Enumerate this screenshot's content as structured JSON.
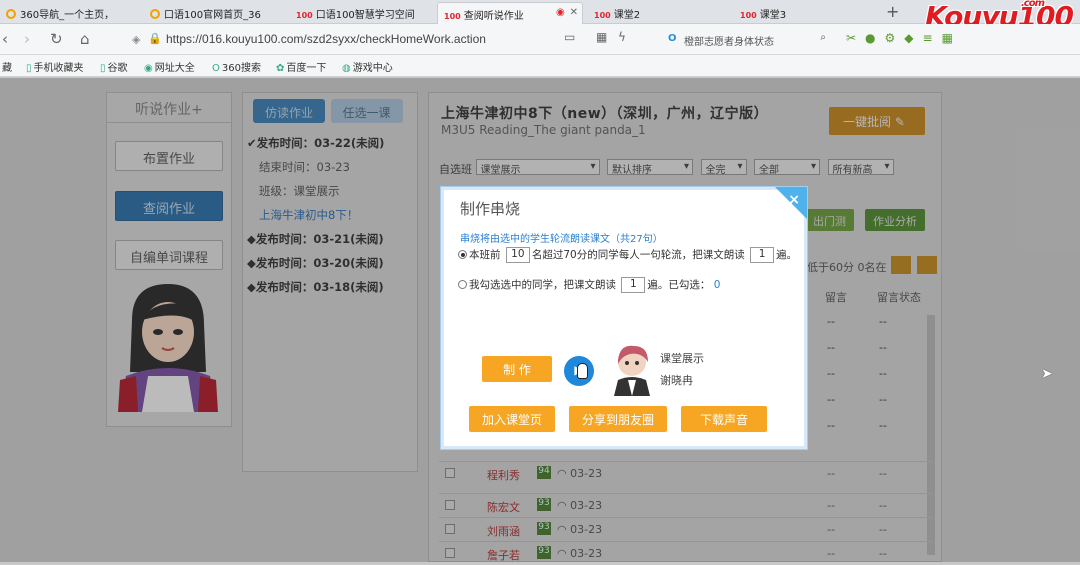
{
  "browser": {
    "tabs": [
      {
        "label": "360导航_一个主页，"
      },
      {
        "label": "口语100官网首页_36"
      },
      {
        "label": "口语100智慧学习空间"
      },
      {
        "label": "查阅听说作业"
      },
      {
        "label": "课堂2"
      },
      {
        "label": "课堂3"
      }
    ],
    "new_tab": "+",
    "url": "https://016.kouyu100.com/szd2syxx/checkHomeWork.action",
    "search_text": "橙部志愿者身体状态",
    "brand_logo": "Kouyu100",
    "brand_logo_suffix": ".com",
    "bookmarks": [
      "手机收藏夹",
      "谷歌",
      "网址大全",
      "360搜索",
      "百度一下",
      "游戏中心"
    ]
  },
  "left_panel": {
    "header": "听说作业+",
    "buttons": [
      "布置作业",
      "查阅作业",
      "自编单词课程"
    ]
  },
  "mid_panel": {
    "tabs": [
      "仿读作业",
      "任选一课"
    ],
    "tree": [
      {
        "label": "发布时间：03-22(未阅)"
      },
      {
        "label": "结束时间：03-23"
      },
      {
        "label": "班级：课堂展示"
      },
      {
        "label": "上海牛津初中8下！"
      },
      {
        "label": "发布时间：03-21(未阅)"
      },
      {
        "label": "发布时间：03-20(未阅)"
      },
      {
        "label": "发布时间：03-18(未阅)"
      }
    ]
  },
  "main_panel": {
    "title": "上海牛津初中8下（new）（深圳，广州，辽宁版）",
    "subtitle": "M3U5 Reading_The giant panda_1",
    "one_key_button": "一键批阅",
    "filter_label": "自选班",
    "filters": [
      "课堂展示",
      "默认排序",
      "全完",
      "全部",
      "所有新高"
    ],
    "green_buttons": [
      "出门测",
      "作业分析"
    ],
    "stat_text": "低于60分 0名在",
    "col_headers": [
      "留言",
      "留言状态"
    ],
    "rows": [
      {
        "name": "程利秀",
        "score": "94",
        "date": "03-23",
        "c1": "--",
        "c2": "--"
      },
      {
        "name": "陈宏文",
        "score": "93",
        "date": "03-23",
        "c1": "--",
        "c2": "--"
      },
      {
        "name": "刘雨涵",
        "score": "93",
        "date": "03-23",
        "c1": "--",
        "c2": "--"
      },
      {
        "name": "詹子若",
        "score": "93",
        "date": "03-23",
        "c1": "--",
        "c2": "--"
      }
    ],
    "dash": "--"
  },
  "modal": {
    "title": "制作串烧",
    "desc": "串烧将由选中的学生轮流朗读课文（共27句）",
    "option1_prefix": "本班前",
    "option1_num": "10",
    "option1_mid": "名超过70分的同学每人一句轮流，把课文朗读",
    "option1_times": "1",
    "option1_suffix": "遍。",
    "option2_prefix": "我勾选选中的同学，把课文朗读",
    "option2_times": "1",
    "option2_mid": "遍。已勾选：",
    "option2_count": "0",
    "make_button": "制 作",
    "play_icon": "play-icon",
    "info_class": "课堂展示",
    "info_name": "谢晓冉",
    "add_button": "加入课堂页",
    "share_button": "分享到朋友圈",
    "download_button": "下载声音",
    "close": "×"
  }
}
